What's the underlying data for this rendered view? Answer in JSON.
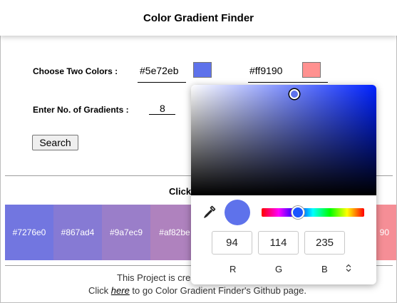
{
  "header": {
    "title": "Color Gradient Finder"
  },
  "form": {
    "choose_label": "Choose Two Colors :",
    "color1": {
      "value": "#5e72eb",
      "swatch": "#5e72eb"
    },
    "color2": {
      "value": "#ff9190",
      "swatch": "#ff9190"
    },
    "gradients_label": "Enter No. of Gradients :",
    "gradients_value": "8",
    "search_label": "Search"
  },
  "results": {
    "title_visible": "Click",
    "cells": [
      {
        "label": "#7276e0",
        "color": "#7276e0"
      },
      {
        "label": "#867ad4",
        "color": "#867ad4"
      },
      {
        "label": "#9a7ec9",
        "color": "#9a7ec9"
      },
      {
        "label": "#af82be",
        "color": "#af82be"
      }
    ],
    "last_cell": {
      "label": "90",
      "color": "#f58e96"
    }
  },
  "footer": {
    "line1": "This Project is crea",
    "line2_pre": "Click ",
    "line2_link": "here",
    "line2_post": " to go Color Gradient Finder's Github page."
  },
  "picker": {
    "preview_color": "#5e72eb",
    "r": "94",
    "g": "114",
    "b": "235",
    "r_label": "R",
    "g_label": "G",
    "b_label": "B",
    "mode_icon": "⌃⌄"
  }
}
